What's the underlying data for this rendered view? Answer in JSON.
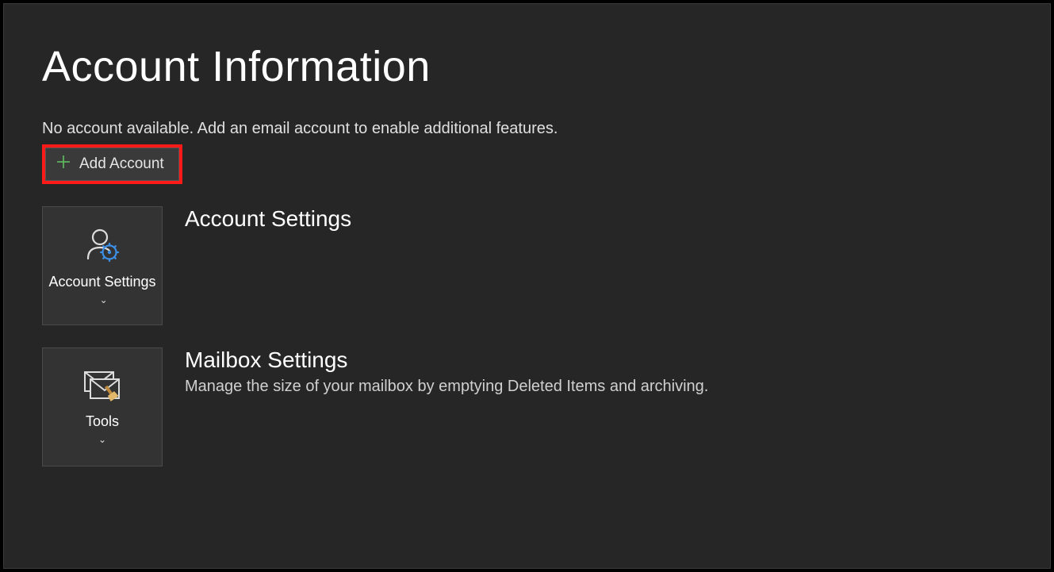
{
  "page": {
    "title": "Account Information",
    "no_account_msg": "No account available. Add an email account to enable additional features.",
    "add_account_label": "Add Account"
  },
  "sections": {
    "account_settings": {
      "tile_label": "Account Settings",
      "heading": "Account Settings"
    },
    "mailbox_settings": {
      "tile_label": "Tools",
      "heading": "Mailbox Settings",
      "description": "Manage the size of your mailbox by emptying Deleted Items and archiving."
    }
  }
}
